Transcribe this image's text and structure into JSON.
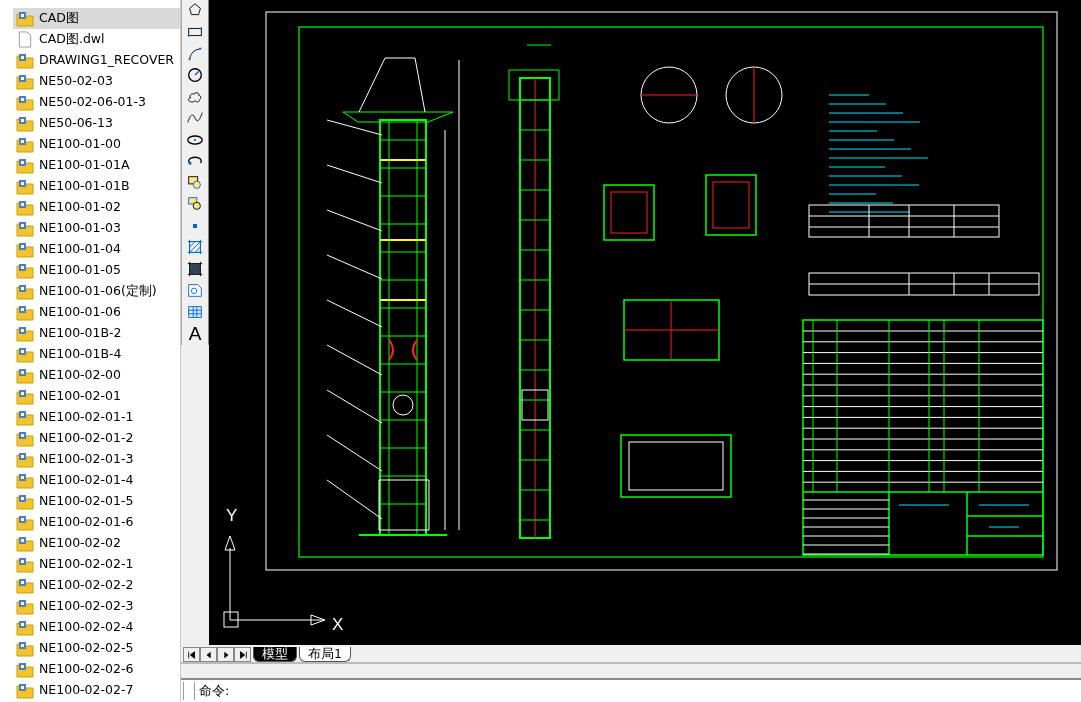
{
  "files": [
    {
      "name": "CAD图",
      "kind": "folder",
      "selected": true
    },
    {
      "name": "CAD图.dwl",
      "kind": "file",
      "selected": false
    },
    {
      "name": "DRAWING1_RECOVER",
      "kind": "folder",
      "selected": false
    },
    {
      "name": "NE50-02-03",
      "kind": "folder",
      "selected": false
    },
    {
      "name": "NE50-02-06-01-3",
      "kind": "folder",
      "selected": false
    },
    {
      "name": "NE50-06-13",
      "kind": "folder",
      "selected": false
    },
    {
      "name": "NE100-01-00",
      "kind": "folder",
      "selected": false
    },
    {
      "name": "NE100-01-01A",
      "kind": "folder",
      "selected": false
    },
    {
      "name": "NE100-01-01B",
      "kind": "folder",
      "selected": false
    },
    {
      "name": "NE100-01-02",
      "kind": "folder",
      "selected": false
    },
    {
      "name": "NE100-01-03",
      "kind": "folder",
      "selected": false
    },
    {
      "name": "NE100-01-04",
      "kind": "folder",
      "selected": false
    },
    {
      "name": "NE100-01-05",
      "kind": "folder",
      "selected": false
    },
    {
      "name": "NE100-01-06(定制)",
      "kind": "folder",
      "selected": false
    },
    {
      "name": "NE100-01-06",
      "kind": "folder",
      "selected": false
    },
    {
      "name": "NE100-01B-2",
      "kind": "folder",
      "selected": false
    },
    {
      "name": "NE100-01B-4",
      "kind": "folder",
      "selected": false
    },
    {
      "name": "NE100-02-00",
      "kind": "folder",
      "selected": false
    },
    {
      "name": "NE100-02-01",
      "kind": "folder",
      "selected": false
    },
    {
      "name": "NE100-02-01-1",
      "kind": "folder",
      "selected": false
    },
    {
      "name": "NE100-02-01-2",
      "kind": "folder",
      "selected": false
    },
    {
      "name": "NE100-02-01-3",
      "kind": "folder",
      "selected": false
    },
    {
      "name": "NE100-02-01-4",
      "kind": "folder",
      "selected": false
    },
    {
      "name": "NE100-02-01-5",
      "kind": "folder",
      "selected": false
    },
    {
      "name": "NE100-02-01-6",
      "kind": "folder",
      "selected": false
    },
    {
      "name": "NE100-02-02",
      "kind": "folder",
      "selected": false
    },
    {
      "name": "NE100-02-02-1",
      "kind": "folder",
      "selected": false
    },
    {
      "name": "NE100-02-02-2",
      "kind": "folder",
      "selected": false
    },
    {
      "name": "NE100-02-02-3",
      "kind": "folder",
      "selected": false
    },
    {
      "name": "NE100-02-02-4",
      "kind": "folder",
      "selected": false
    },
    {
      "name": "NE100-02-02-5",
      "kind": "folder",
      "selected": false
    },
    {
      "name": "NE100-02-02-6",
      "kind": "folder",
      "selected": false
    },
    {
      "name": "NE100-02-02-7",
      "kind": "folder",
      "selected": false
    }
  ],
  "toolbar": {
    "text_tool": "A"
  },
  "canvas": {
    "ucs": {
      "y_label": "Y",
      "x_label": "X"
    }
  },
  "layout_tabs": [
    {
      "label": "模型",
      "selected": true
    },
    {
      "label": "布局1",
      "selected": false
    }
  ],
  "command_line": {
    "prompt": "命令:"
  }
}
